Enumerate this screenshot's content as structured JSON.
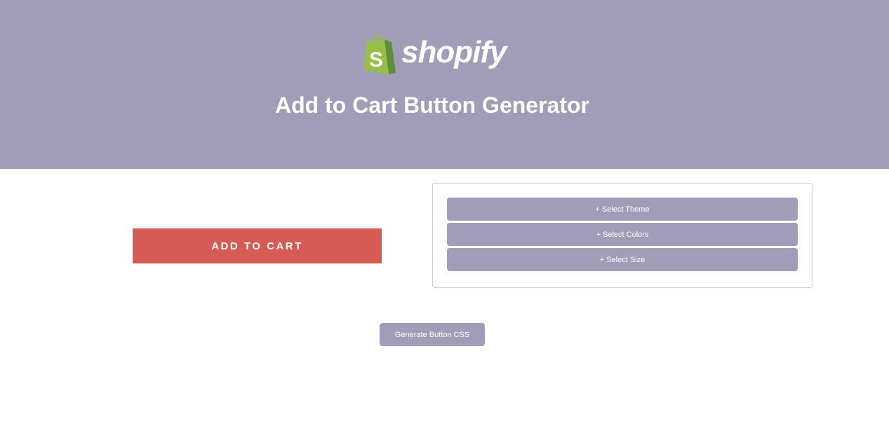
{
  "header": {
    "logo_text": "shopify",
    "title": "Add to Cart Button Generator",
    "background_color": "#a19cb7",
    "logo_icon": "shopify-bag-icon"
  },
  "preview": {
    "button_label": "ADD TO CART",
    "button_color": "#d65b54"
  },
  "options": {
    "items": [
      {
        "label": "+ Select Theme"
      },
      {
        "label": "+ Select Colors"
      },
      {
        "label": "+ Select Size"
      }
    ]
  },
  "actions": {
    "generate_label": "Generate Button CSS"
  }
}
